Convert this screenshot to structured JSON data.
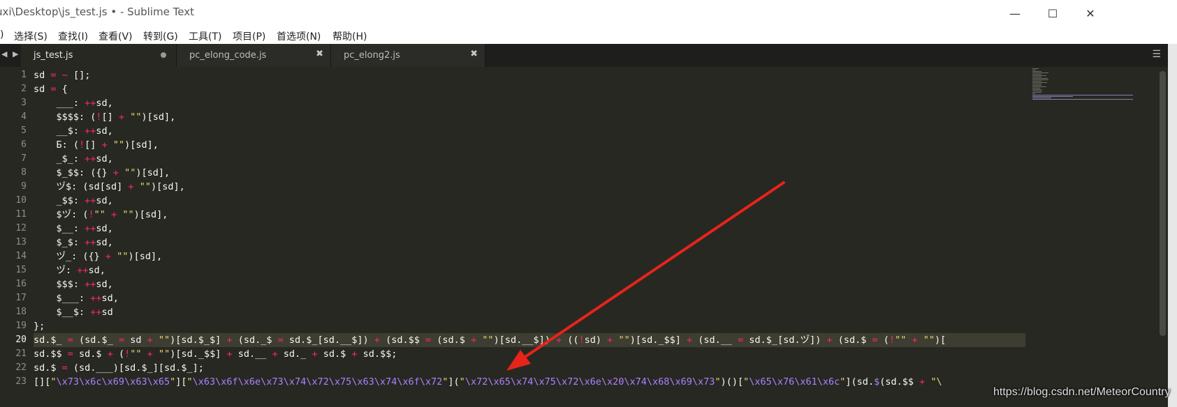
{
  "window": {
    "title": "uxi\\Desktop\\js_test.js • - Sublime Text",
    "minimize": "—",
    "maximize": "☐",
    "close": "✕"
  },
  "menu": [
    ")",
    "选择(S)",
    "查找(I)",
    "查看(V)",
    "转到(G)",
    "工具(T)",
    "项目(P)",
    "首选项(N)",
    "帮助(H)"
  ],
  "tabs": [
    {
      "label": "js_test.js",
      "active": true,
      "modified": true
    },
    {
      "label": "pc_elong_code.js",
      "active": false,
      "modified": false
    },
    {
      "label": "pc_elong2.js",
      "active": false,
      "modified": false
    }
  ],
  "tab_nav": {
    "prev": "◀",
    "next": "▶",
    "menu": "☰"
  },
  "editor": {
    "current_line": 20,
    "line_numbers": [
      "1",
      "2",
      "3",
      "4",
      "5",
      "6",
      "7",
      "8",
      "9",
      "10",
      "11",
      "12",
      "13",
      "14",
      "15",
      "16",
      "17",
      "18",
      "19",
      "20",
      "21",
      "22",
      "23"
    ],
    "lines": [
      [
        {
          "t": "sd "
        },
        {
          "t": "=",
          "k": "k"
        },
        {
          "t": " "
        },
        {
          "t": "~",
          "k": "k"
        },
        {
          "t": " [];"
        }
      ],
      [
        {
          "t": "sd "
        },
        {
          "t": "=",
          "k": "k"
        },
        {
          "t": " {"
        }
      ],
      [
        {
          "t": "    ___: "
        },
        {
          "t": "++",
          "k": "k"
        },
        {
          "t": "sd,"
        }
      ],
      [
        {
          "t": "    $$$$: ("
        },
        {
          "t": "!",
          "k": "k"
        },
        {
          "t": "[] "
        },
        {
          "t": "+",
          "k": "k"
        },
        {
          "t": " "
        },
        {
          "t": "\"\"",
          "k": "s"
        },
        {
          "t": ")[sd],"
        }
      ],
      [
        {
          "t": "    __$: "
        },
        {
          "t": "++",
          "k": "k"
        },
        {
          "t": "sd,"
        }
      ],
      [
        {
          "t": "    Б: ("
        },
        {
          "t": "!",
          "k": "k"
        },
        {
          "t": "[] "
        },
        {
          "t": "+",
          "k": "k"
        },
        {
          "t": " "
        },
        {
          "t": "\"\"",
          "k": "s"
        },
        {
          "t": ")[sd],"
        }
      ],
      [
        {
          "t": "    _$_: "
        },
        {
          "t": "++",
          "k": "k"
        },
        {
          "t": "sd,"
        }
      ],
      [
        {
          "t": "    $_$$: ({} "
        },
        {
          "t": "+",
          "k": "k"
        },
        {
          "t": " "
        },
        {
          "t": "\"\"",
          "k": "s"
        },
        {
          "t": ")[sd],"
        }
      ],
      [
        {
          "t": "    ヅ$: (sd[sd] "
        },
        {
          "t": "+",
          "k": "k"
        },
        {
          "t": " "
        },
        {
          "t": "\"\"",
          "k": "s"
        },
        {
          "t": ")[sd],"
        }
      ],
      [
        {
          "t": "    _$$: "
        },
        {
          "t": "++",
          "k": "k"
        },
        {
          "t": "sd,"
        }
      ],
      [
        {
          "t": "    $ヅ: ("
        },
        {
          "t": "!",
          "k": "k"
        },
        {
          "t": "\"\"",
          "k": "s"
        },
        {
          "t": " "
        },
        {
          "t": "+",
          "k": "k"
        },
        {
          "t": " "
        },
        {
          "t": "\"\"",
          "k": "s"
        },
        {
          "t": ")[sd],"
        }
      ],
      [
        {
          "t": "    $__: "
        },
        {
          "t": "++",
          "k": "k"
        },
        {
          "t": "sd,"
        }
      ],
      [
        {
          "t": "    $_$: "
        },
        {
          "t": "++",
          "k": "k"
        },
        {
          "t": "sd,"
        }
      ],
      [
        {
          "t": "    ヅ_: ({} "
        },
        {
          "t": "+",
          "k": "k"
        },
        {
          "t": " "
        },
        {
          "t": "\"\"",
          "k": "s"
        },
        {
          "t": ")[sd],"
        }
      ],
      [
        {
          "t": "    ヅ: "
        },
        {
          "t": "++",
          "k": "k"
        },
        {
          "t": "sd,"
        }
      ],
      [
        {
          "t": "    $$$: "
        },
        {
          "t": "++",
          "k": "k"
        },
        {
          "t": "sd,"
        }
      ],
      [
        {
          "t": "    $___: "
        },
        {
          "t": "++",
          "k": "k"
        },
        {
          "t": "sd,"
        }
      ],
      [
        {
          "t": "    $__$: "
        },
        {
          "t": "++",
          "k": "k"
        },
        {
          "t": "sd"
        }
      ],
      [
        {
          "t": "};"
        }
      ],
      [
        {
          "t": "sd.$_ "
        },
        {
          "t": "=",
          "k": "k"
        },
        {
          "t": " (sd.$_ "
        },
        {
          "t": "=",
          "k": "k"
        },
        {
          "t": " sd "
        },
        {
          "t": "+",
          "k": "k"
        },
        {
          "t": " "
        },
        {
          "t": "\"\"",
          "k": "s"
        },
        {
          "t": ")[sd.$_$] "
        },
        {
          "t": "+",
          "k": "k"
        },
        {
          "t": " (sd._$ "
        },
        {
          "t": "=",
          "k": "k"
        },
        {
          "t": " sd.$_[sd.__$]) "
        },
        {
          "t": "+",
          "k": "k"
        },
        {
          "t": " (sd.$$ "
        },
        {
          "t": "=",
          "k": "k"
        },
        {
          "t": " (sd.$ "
        },
        {
          "t": "+",
          "k": "k"
        },
        {
          "t": " "
        },
        {
          "t": "\"\"",
          "k": "s"
        },
        {
          "t": ")[sd.__$]) "
        },
        {
          "t": "+",
          "k": "k"
        },
        {
          "t": " (("
        },
        {
          "t": "!",
          "k": "k"
        },
        {
          "t": "sd) "
        },
        {
          "t": "+",
          "k": "k"
        },
        {
          "t": " "
        },
        {
          "t": "\"\"",
          "k": "s"
        },
        {
          "t": ")[sd._$$] "
        },
        {
          "t": "+",
          "k": "k"
        },
        {
          "t": " (sd.__ "
        },
        {
          "t": "=",
          "k": "k"
        },
        {
          "t": " sd.$_[sd.ヅ]) "
        },
        {
          "t": "+",
          "k": "k"
        },
        {
          "t": " (sd.$ "
        },
        {
          "t": "=",
          "k": "k"
        },
        {
          "t": " ("
        },
        {
          "t": "!",
          "k": "k"
        },
        {
          "t": "\"\"",
          "k": "s"
        },
        {
          "t": " "
        },
        {
          "t": "+",
          "k": "k"
        },
        {
          "t": " "
        },
        {
          "t": "\"\"",
          "k": "s"
        },
        {
          "t": ")["
        }
      ],
      [
        {
          "t": "sd.$$ "
        },
        {
          "t": "=",
          "k": "k"
        },
        {
          "t": " sd.$ "
        },
        {
          "t": "+",
          "k": "k"
        },
        {
          "t": " ("
        },
        {
          "t": "!",
          "k": "k"
        },
        {
          "t": "\"\"",
          "k": "s"
        },
        {
          "t": " "
        },
        {
          "t": "+",
          "k": "k"
        },
        {
          "t": " "
        },
        {
          "t": "\"\"",
          "k": "s"
        },
        {
          "t": ")[sd._$$] "
        },
        {
          "t": "+",
          "k": "k"
        },
        {
          "t": " sd.__ "
        },
        {
          "t": "+",
          "k": "k"
        },
        {
          "t": " sd._ "
        },
        {
          "t": "+",
          "k": "k"
        },
        {
          "t": " sd.$ "
        },
        {
          "t": "+",
          "k": "k"
        },
        {
          "t": " sd.$$;"
        }
      ],
      [
        {
          "t": "sd.$ "
        },
        {
          "t": "=",
          "k": "k"
        },
        {
          "t": " (sd.___)[sd.$_][sd.$_];"
        }
      ],
      [
        {
          "t": "[]["
        },
        {
          "t": "\"",
          "k": "s"
        },
        {
          "t": "\\x73\\x6c\\x69\\x63\\x65",
          "k": "c"
        },
        {
          "t": "\"",
          "k": "s"
        },
        {
          "t": "]["
        },
        {
          "t": "\"",
          "k": "s"
        },
        {
          "t": "\\x63\\x6f\\x6e\\x73\\x74\\x72\\x75\\x63\\x74\\x6f\\x72",
          "k": "c"
        },
        {
          "t": "\"",
          "k": "s"
        },
        {
          "t": "]("
        },
        {
          "t": "\"",
          "k": "s"
        },
        {
          "t": "\\x72\\x65\\x74\\x75\\x72\\x6e\\x20\\x74\\x68\\x69\\x73",
          "k": "c"
        },
        {
          "t": "\"",
          "k": "s"
        },
        {
          "t": ")()["
        },
        {
          "t": "\"",
          "k": "s"
        },
        {
          "t": "\\x65\\x76\\x61\\x6c",
          "k": "c"
        },
        {
          "t": "\"",
          "k": "s"
        },
        {
          "t": "](sd."
        },
        {
          "t": "$",
          "k": "c"
        },
        {
          "t": "(sd.$$ "
        },
        {
          "t": "+",
          "k": "k"
        },
        {
          "t": " "
        },
        {
          "t": "\"\\",
          "k": "s"
        }
      ]
    ]
  },
  "watermark": "https://blog.csdn.net/MeteorCountry",
  "colors": {
    "editor_bg": "#272822",
    "keyword": "#f92672",
    "string": "#e6db74",
    "constant": "#ae81ff",
    "arrow": "#e8231a"
  }
}
